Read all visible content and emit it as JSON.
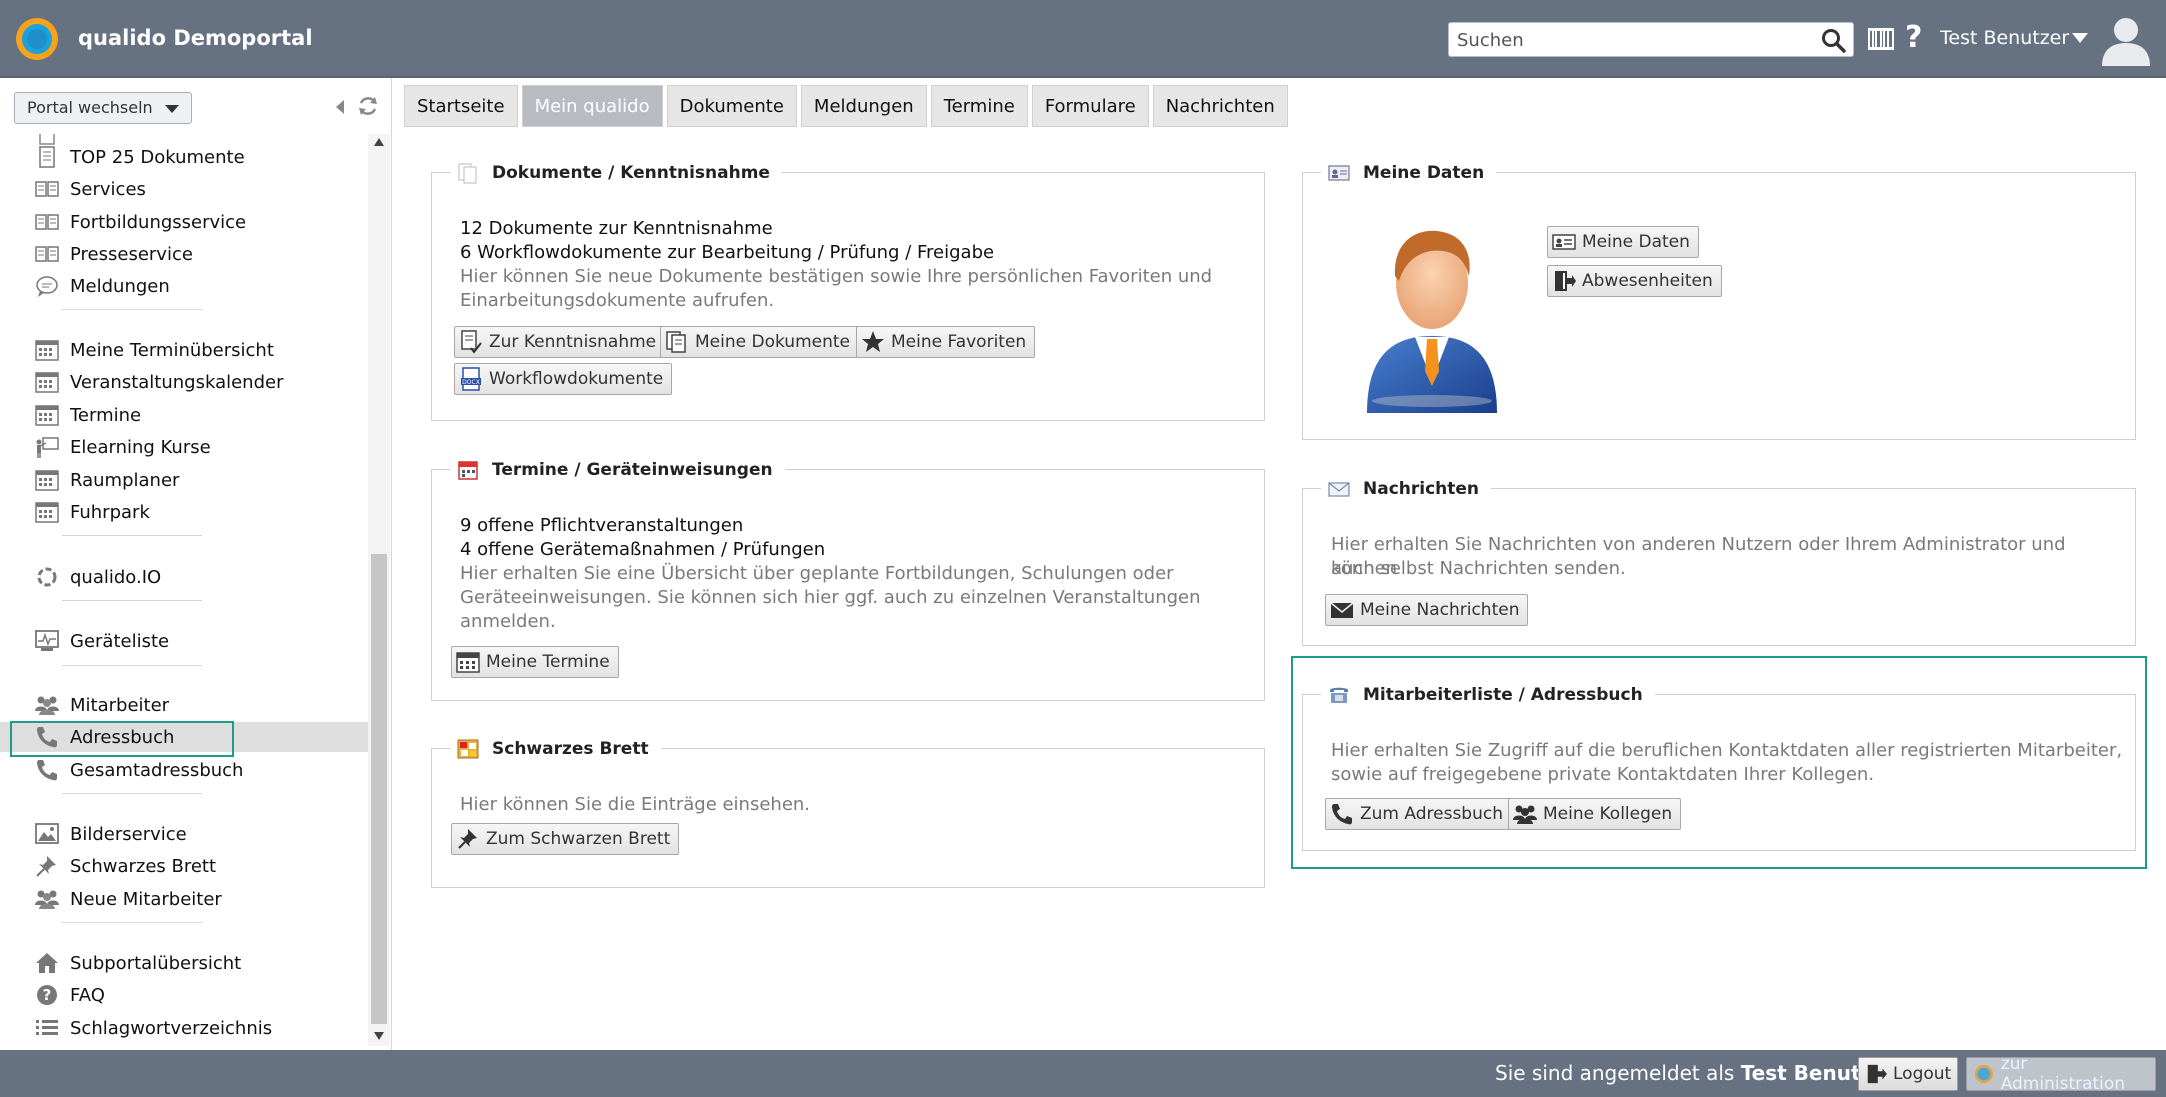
{
  "header": {
    "app_title": "qualido Demoportal",
    "search_placeholder": "Suchen",
    "help_label": "?",
    "user_name": "Test Benutzer"
  },
  "sidebar": {
    "portal_switch_label": "Portal wechseln",
    "items": [
      {
        "label": "TOP 25 Dokumente",
        "icon": "document-icon"
      },
      {
        "label": "Services",
        "icon": "book-icon"
      },
      {
        "label": "Fortbildungsservice",
        "icon": "book-icon"
      },
      {
        "label": "Presseservice",
        "icon": "book-icon"
      },
      {
        "label": "Meldungen",
        "icon": "speech-bubble-icon"
      },
      {
        "label": "Meine Terminübersicht",
        "icon": "calendar-icon"
      },
      {
        "label": "Veranstaltungskalender",
        "icon": "calendar-icon"
      },
      {
        "label": "Termine",
        "icon": "calendar-icon"
      },
      {
        "label": "Elearning Kurse",
        "icon": "presentation-icon"
      },
      {
        "label": "Raumplaner",
        "icon": "calendar-icon"
      },
      {
        "label": "Fuhrpark",
        "icon": "calendar-icon"
      },
      {
        "label": "qualido.IO",
        "icon": "circle-loader-icon"
      },
      {
        "label": "Geräteliste",
        "icon": "monitor-chart-icon"
      },
      {
        "label": "Mitarbeiter",
        "icon": "users-icon"
      },
      {
        "label": "Adressbuch",
        "icon": "phone-icon",
        "active": true
      },
      {
        "label": "Gesamtadressbuch",
        "icon": "phone-icon"
      },
      {
        "label": "Bilderservice",
        "icon": "image-icon"
      },
      {
        "label": "Schwarzes Brett",
        "icon": "pin-icon"
      },
      {
        "label": "Neue Mitarbeiter",
        "icon": "users-icon"
      },
      {
        "label": "Subportalübersicht",
        "icon": "home-icon"
      },
      {
        "label": "FAQ",
        "icon": "question-icon"
      },
      {
        "label": "Schlagwortverzeichnis",
        "icon": "list-icon"
      }
    ]
  },
  "tabs": [
    {
      "label": "Startseite",
      "active": false
    },
    {
      "label": "Mein qualido",
      "active": true
    },
    {
      "label": "Dokumente",
      "active": false
    },
    {
      "label": "Meldungen",
      "active": false
    },
    {
      "label": "Termine",
      "active": false
    },
    {
      "label": "Formulare",
      "active": false
    },
    {
      "label": "Nachrichten",
      "active": false
    }
  ],
  "panels": {
    "dokumente": {
      "title": "Dokumente / Kenntnisnahme",
      "line1": "12 Dokumente zur Kenntnisnahme",
      "line2": "6 Workflowdokumente zur Bearbeitung / Prüfung / Freigabe",
      "desc1": "Hier können Sie neue Dokumente bestätigen sowie Ihre persönlichen Favoriten und",
      "desc2": "Einarbeitungsdokumente aufrufen.",
      "btn_kenntnis": "Zur Kenntnisnahme",
      "btn_meine_dok": "Meine Dokumente",
      "btn_favoriten": "Meine Favoriten",
      "btn_workflow": "Workflowdokumente"
    },
    "termine": {
      "title": "Termine / Geräteinweisungen",
      "line1": "9 offene Pflichtveranstaltungen",
      "line2": "4 offene Gerätemaßnahmen / Prüfungen",
      "desc1": "Hier erhalten Sie eine Übersicht über geplante Fortbildungen, Schulungen oder",
      "desc2": "Geräteeinweisungen. Sie können sich hier ggf. auch zu einzelnen Veranstaltungen",
      "desc3": "anmelden.",
      "btn_termine": "Meine Termine"
    },
    "brett": {
      "title": "Schwarzes Brett",
      "desc1": "Hier können Sie die Einträge einsehen.",
      "btn_brett": "Zum Schwarzen Brett"
    },
    "daten": {
      "title": "Meine Daten",
      "btn_daten": "Meine Daten",
      "btn_abwesen": "Abwesenheiten"
    },
    "nachrichten": {
      "title": "Nachrichten",
      "desc1": "Hier erhalten Sie Nachrichten von anderen Nutzern oder Ihrem Administrator und können",
      "desc2": "auch selbst Nachrichten senden.",
      "btn_nachrichten": "Meine Nachrichten"
    },
    "mitarbeiter": {
      "title": "Mitarbeiterliste / Adressbuch",
      "desc1": "Hier erhalten Sie Zugriff auf die beruflichen Kontaktdaten aller registrierten Mitarbeiter,",
      "desc2": "sowie auf freigegebene private Kontaktdaten Ihrer Kollegen.",
      "btn_adressbuch": "Zum Adressbuch",
      "btn_kollegen": "Meine Kollegen"
    }
  },
  "footer": {
    "logged_in_prefix": "Sie sind angemeldet als ",
    "logged_in_user": "Test Benutzer",
    "logout_label": "Logout",
    "admin_label": "zur Administration"
  },
  "colors": {
    "header_bg": "#667281",
    "highlight": "#1c9c8c",
    "active_tab": "#b8bcc2"
  }
}
